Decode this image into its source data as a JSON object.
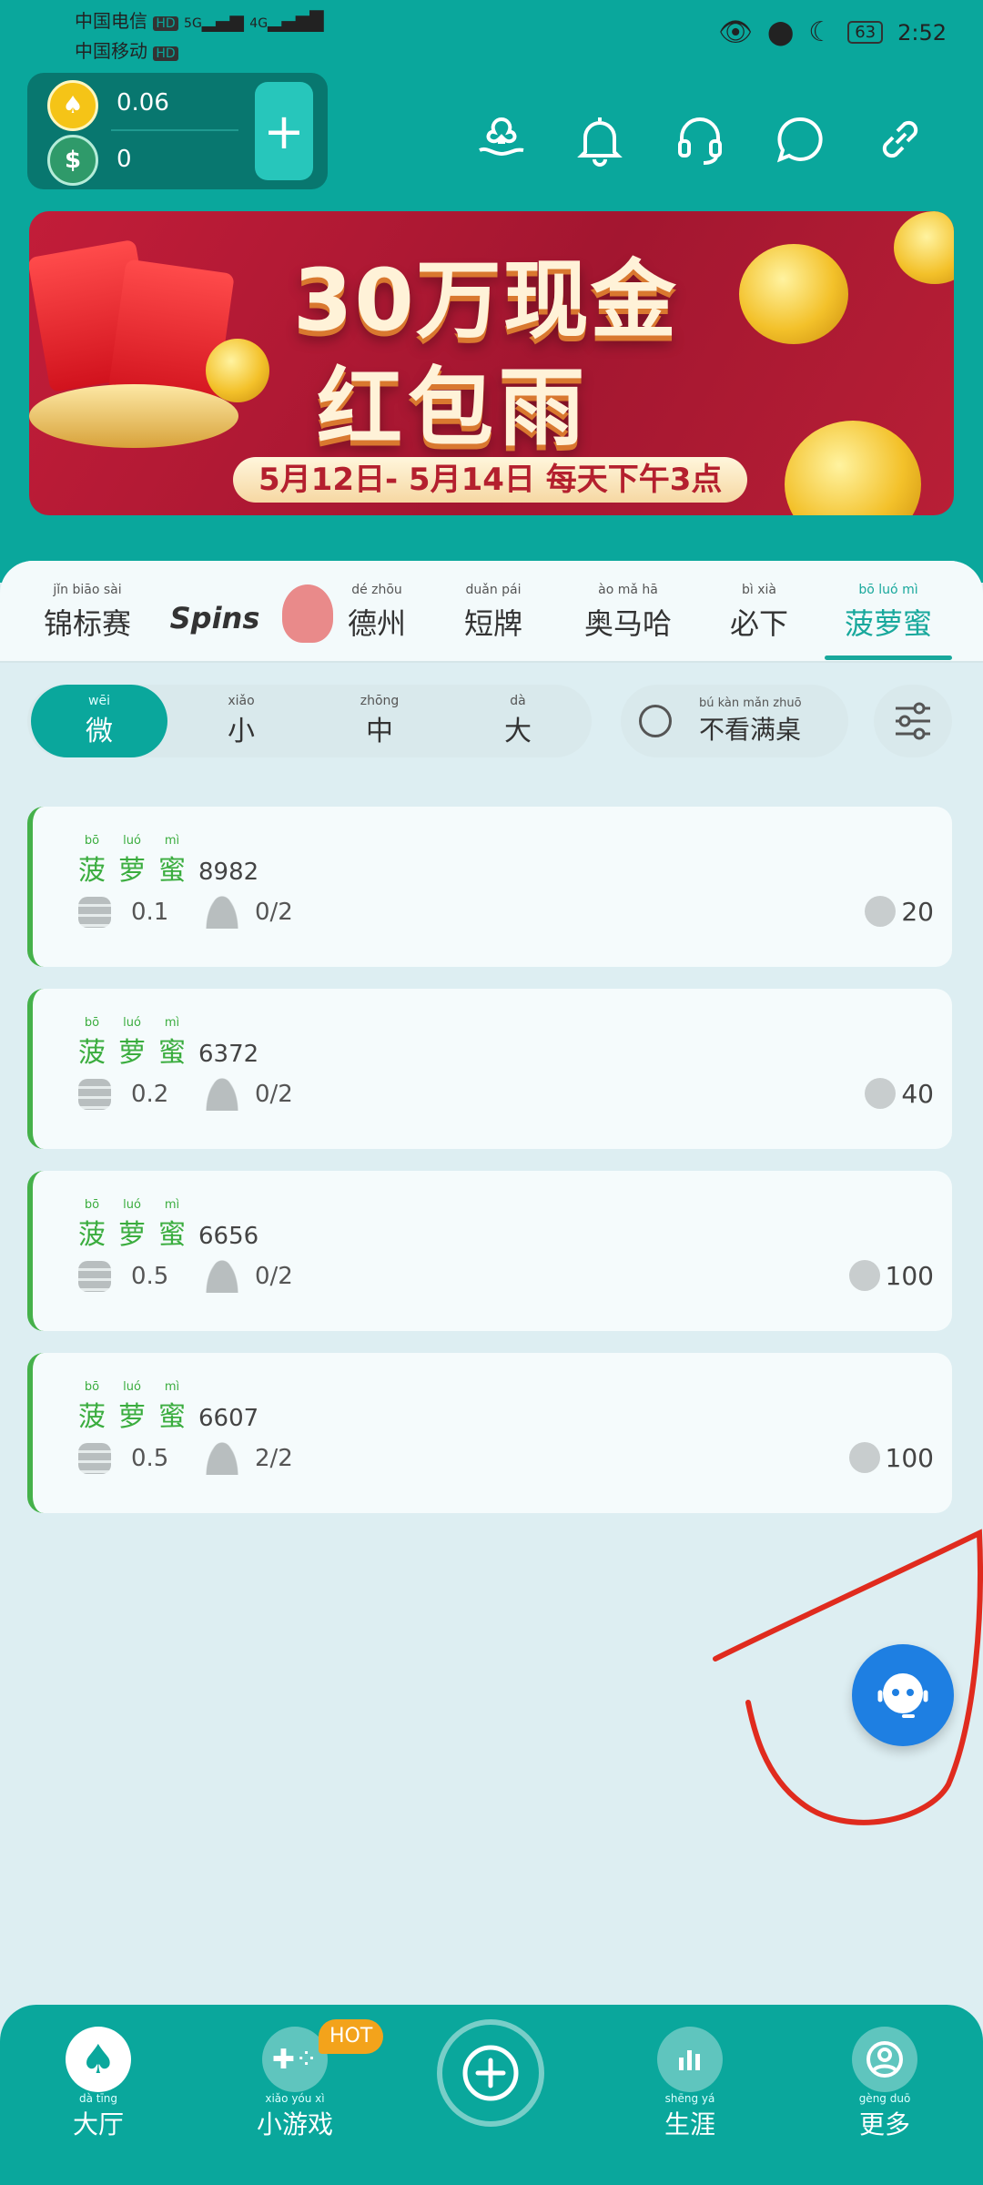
{
  "statusbar": {
    "carrier1": "中国电信",
    "carrier2": "中国移动",
    "net1": "5G",
    "net2": "4G",
    "hd": "HD",
    "battery": "63",
    "time": "2:52"
  },
  "wallet": {
    "coins": "0.06",
    "cash": "0",
    "coin_symbol": "♠",
    "cash_symbol": "$",
    "add_label": "+"
  },
  "header_icons": [
    "support-hand-icon",
    "bell-icon",
    "headset-icon",
    "chat-icon",
    "link-icon"
  ],
  "banner": {
    "line1": "30万现金",
    "line2": "红包雨",
    "date": "5月12日- 5月14日 每天下午3点"
  },
  "tabs": [
    {
      "label": "锦标赛",
      "pinyin": "jǐn biāo sài"
    },
    {
      "label": "Spins",
      "pinyin": ""
    },
    {
      "label": "德州",
      "pinyin": "dé zhōu"
    },
    {
      "label": "短牌",
      "pinyin": "duǎn pái"
    },
    {
      "label": "奥马哈",
      "pinyin": "ào mǎ hā"
    },
    {
      "label": "必下",
      "pinyin": "bì xià"
    },
    {
      "label": "菠萝蜜",
      "pinyin": "bō luó mì"
    }
  ],
  "stakes": [
    {
      "label": "微",
      "pinyin": "wēi"
    },
    {
      "label": "小",
      "pinyin": "xiǎo"
    },
    {
      "label": "中",
      "pinyin": "zhōng"
    },
    {
      "label": "大",
      "pinyin": "dà"
    }
  ],
  "filter": {
    "hide_full": "不看满桌",
    "hide_full_pinyin": "bú kàn mǎn zhuō"
  },
  "table_name_chars": [
    {
      "c": "菠",
      "py": "bō"
    },
    {
      "c": "萝",
      "py": "luó"
    },
    {
      "c": "蜜",
      "py": "mì"
    }
  ],
  "tables": [
    {
      "id": "8982",
      "blind": "0.1",
      "players": "0/2",
      "buyin": "20"
    },
    {
      "id": "6372",
      "blind": "0.2",
      "players": "0/2",
      "buyin": "40"
    },
    {
      "id": "6656",
      "blind": "0.5",
      "players": "0/2",
      "buyin": "100"
    },
    {
      "id": "6607",
      "blind": "0.5",
      "players": "2/2",
      "buyin": "100"
    }
  ],
  "bottom_nav": {
    "lobby": {
      "label": "大厅",
      "pinyin": "dà tīng"
    },
    "games": {
      "label": "小游戏",
      "pinyin": "xiǎo yóu xì",
      "badge": "HOT"
    },
    "career": {
      "label": "生涯",
      "pinyin": "shēng yá"
    },
    "more": {
      "label": "更多",
      "pinyin": "gèng duō"
    }
  },
  "colors": {
    "primary": "#0aa79c",
    "accent_green": "#45b14a",
    "float_blue": "#1e7fe2",
    "hot": "#f3a31b"
  }
}
